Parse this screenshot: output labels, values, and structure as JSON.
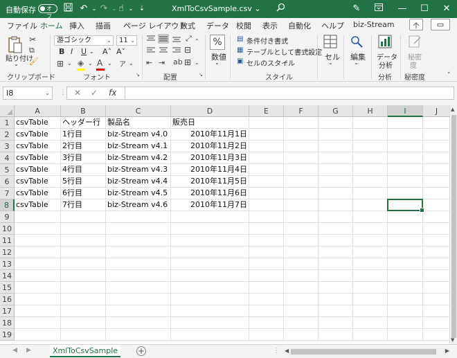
{
  "titlebar": {
    "autosave_label": "自動保存",
    "autosave_state": "オフ",
    "filename": "XmlToCsvSample.csv",
    "filename_dropdown": "⌄",
    "icons": [
      "save-icon",
      "undo-icon",
      "redo-icon",
      "touch-mode-icon",
      "customize-qat-icon",
      "search-icon",
      "pen-icon",
      "ribbon-display-icon",
      "minimize-icon",
      "maximize-icon",
      "close-icon"
    ]
  },
  "tabs": [
    "ファイル",
    "ホーム",
    "挿入",
    "描画",
    "ページ レイアウト",
    "数式",
    "データ",
    "校閲",
    "表示",
    "自動化",
    "ヘルプ",
    "biz-Stream"
  ],
  "active_tab": "ホーム",
  "ribbon": {
    "clipboard": {
      "paste": "貼り付け",
      "label": "クリップボード"
    },
    "font": {
      "name": "游ゴシック",
      "size": "11",
      "bold": "B",
      "italic": "I",
      "underline": "U",
      "grow": "A˄",
      "shrink": "A˅",
      "label": "フォント"
    },
    "alignment": {
      "label": "配置"
    },
    "number": {
      "percent": "%",
      "label_btn": "数値"
    },
    "styles": {
      "conditional": "条件付き書式",
      "table": "テーブルとして書式設定",
      "cell": "セルのスタイル",
      "label": "スタイル"
    },
    "cells": {
      "label_btn": "セル"
    },
    "editing": {
      "label_btn": "編集"
    },
    "analysis": {
      "btn1": "データ",
      "btn2": "分析",
      "label": "分析"
    },
    "sensitivity": {
      "btn1": "秘密",
      "btn2": "度",
      "label": "秘密度"
    }
  },
  "formula_bar": {
    "name_box": "I8",
    "cancel": "✕",
    "enter": "✓",
    "fx": "fx",
    "formula": ""
  },
  "columns": [
    "A",
    "B",
    "C",
    "D",
    "E",
    "F",
    "G",
    "H",
    "I",
    "J"
  ],
  "selected_column": "I",
  "selected_row": 8,
  "rows": [
    [
      "csvTable",
      "ヘッダー行",
      "製品名",
      "販売日"
    ],
    [
      "csvTable",
      "1行目",
      "biz-Stream v4.0",
      "2010年11月1日"
    ],
    [
      "csvTable",
      "2行目",
      "biz-Stream v4.1",
      "2010年11月2日"
    ],
    [
      "csvTable",
      "3行目",
      "biz-Stream v4.2",
      "2010年11月3日"
    ],
    [
      "csvTable",
      "4行目",
      "biz-Stream v4.3",
      "2010年11月4日"
    ],
    [
      "csvTable",
      "5行目",
      "biz-Stream v4.4",
      "2010年11月5日"
    ],
    [
      "csvTable",
      "6行目",
      "biz-Stream v4.5",
      "2010年11月6日"
    ],
    [
      "csvTable",
      "7行目",
      "biz-Stream v4.6",
      "2010年11月7日"
    ]
  ],
  "row_count": 19,
  "sheet": {
    "name": "XmlToCsvSample",
    "add": "+"
  }
}
